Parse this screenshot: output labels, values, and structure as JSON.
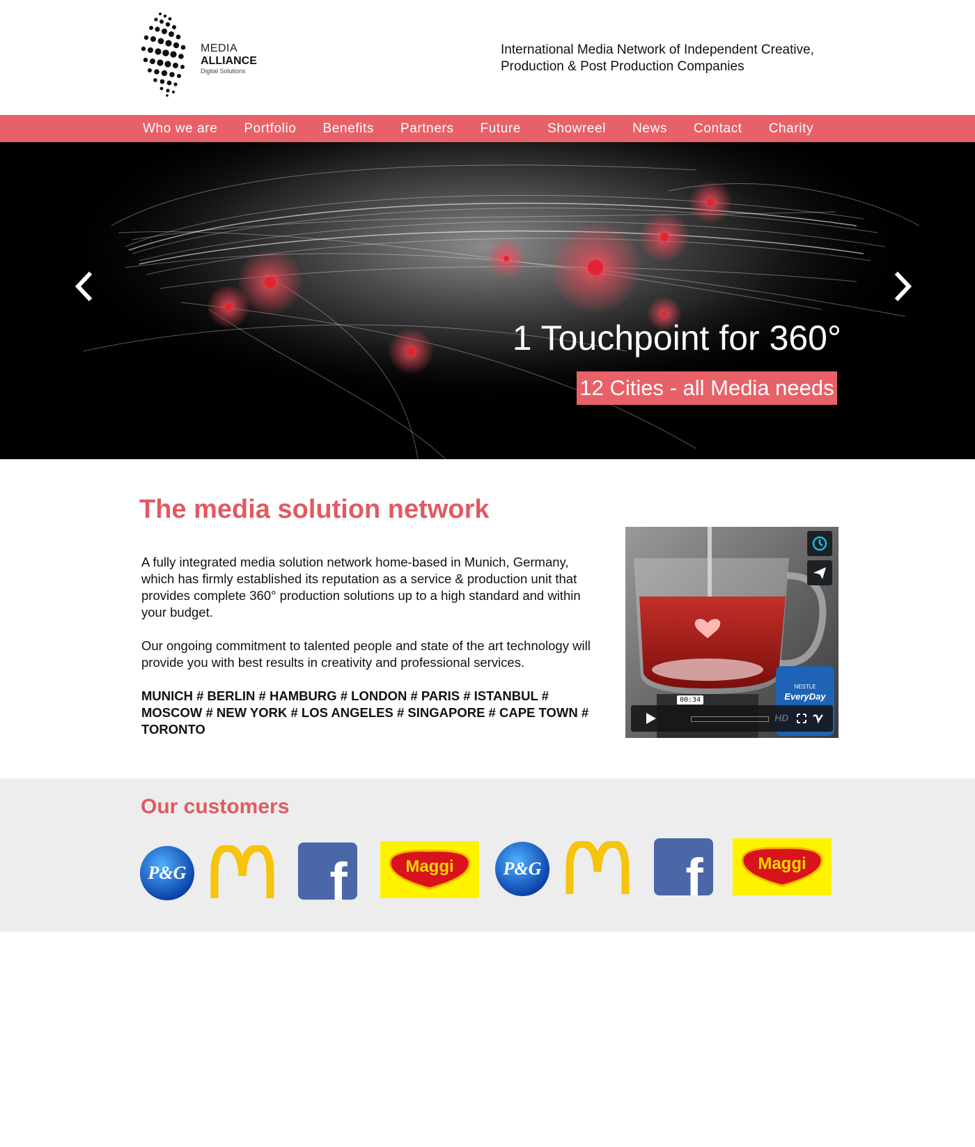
{
  "header": {
    "logo": {
      "line1": "MEDIA",
      "line2": "ALLIANCE",
      "line3": "Digital Solutions"
    },
    "tagline_line1": "International Media Network of Independent Creative,",
    "tagline_line2": "Production & Post Production Companies"
  },
  "nav": {
    "items": [
      {
        "label": "Who we are"
      },
      {
        "label": "Portfolio"
      },
      {
        "label": "Benefits"
      },
      {
        "label": "Partners"
      },
      {
        "label": "Future"
      },
      {
        "label": "Showreel"
      },
      {
        "label": "News"
      },
      {
        "label": "Contact"
      },
      {
        "label": "Charity"
      }
    ]
  },
  "hero": {
    "title": "1 Touchpoint for 360°",
    "subtitle": "12 Cities - all Media needs",
    "prev_icon": "chevron-left-icon",
    "next_icon": "chevron-right-icon"
  },
  "intro": {
    "title": "The media solution network",
    "paragraph1": "A fully integrated media solution network home-based in Munich, Germany, which has firmly established its reputation as a service & production unit that provides complete 360° production solutions up to a high standard and within your budget.",
    "paragraph2": "Our ongoing commitment to talented people and state of the art technology will provide you with best results in creativity and professional services.",
    "cities": "MUNICH # BERLIN # HAMBURG # LONDON # PARIS # ISTANBUL # MOSCOW # NEW YORK # LOS ANGELES # SINGAPORE # CAPE TOWN # TORONTO"
  },
  "video": {
    "timecode": "00:34",
    "hd_label": "HD",
    "product_label_line1": "NESTLE",
    "product_label_line2": "EveryDay",
    "icons": [
      "clock-icon",
      "send-icon",
      "play-icon",
      "fullscreen-icon",
      "vimeo-icon"
    ]
  },
  "customers": {
    "title": "Our customers",
    "logos": [
      {
        "name": "P&G",
        "text": "P&G"
      },
      {
        "name": "McDonald's"
      },
      {
        "name": "Facebook",
        "text": "f"
      },
      {
        "name": "Maggi",
        "text": "Maggi"
      },
      {
        "name": "P&G",
        "text": "P&G"
      },
      {
        "name": "McDonald's"
      },
      {
        "name": "Facebook",
        "text": "f"
      },
      {
        "name": "Maggi",
        "text": "Maggi"
      }
    ]
  },
  "colors": {
    "accent": "#e86168",
    "accent_text": "#e05a63",
    "customers_bg": "#ededed",
    "hero_bg": "#000000"
  }
}
